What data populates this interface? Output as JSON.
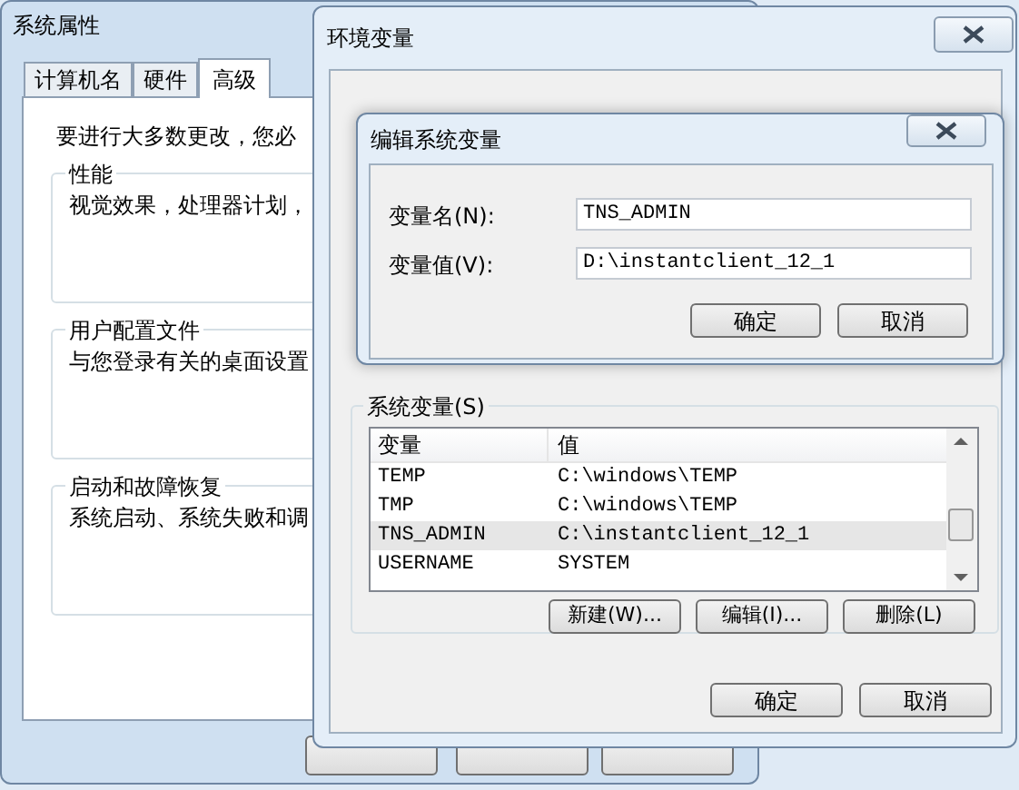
{
  "system_properties": {
    "title": "系统属性",
    "tabs": [
      {
        "label": "计算机名",
        "selected": false
      },
      {
        "label": "硬件",
        "selected": false
      },
      {
        "label": "高级",
        "selected": true
      }
    ],
    "intro": "要进行大多数更改，您必",
    "groups": [
      {
        "title": "性能",
        "text": "视觉效果，处理器计划，"
      },
      {
        "title": "用户配置文件",
        "text": "与您登录有关的桌面设置"
      },
      {
        "title": "启动和故障恢复",
        "text": "系统启动、系统失败和调"
      }
    ]
  },
  "environment_variables": {
    "title": "环境变量",
    "system_variables": {
      "title": "系统变量(S)",
      "columns": [
        "变量",
        "值"
      ],
      "rows": [
        {
          "name": "TEMP",
          "value": "C:\\windows\\TEMP",
          "selected": false
        },
        {
          "name": "TMP",
          "value": "C:\\windows\\TEMP",
          "selected": false
        },
        {
          "name": "TNS_ADMIN",
          "value": "C:\\instantclient_12_1",
          "selected": true
        },
        {
          "name": "USERNAME",
          "value": "SYSTEM",
          "selected": false
        }
      ],
      "buttons": [
        "新建(W)...",
        "编辑(I)...",
        "删除(L)"
      ]
    },
    "buttons": [
      "确定",
      "取消"
    ]
  },
  "edit_dialog": {
    "title": "编辑系统变量",
    "fields": [
      {
        "label": "变量名(N):",
        "value": "TNS_ADMIN"
      },
      {
        "label": "变量值(V):",
        "value": "D:\\instantclient_12_1"
      }
    ],
    "buttons": [
      "确定",
      "取消"
    ]
  }
}
